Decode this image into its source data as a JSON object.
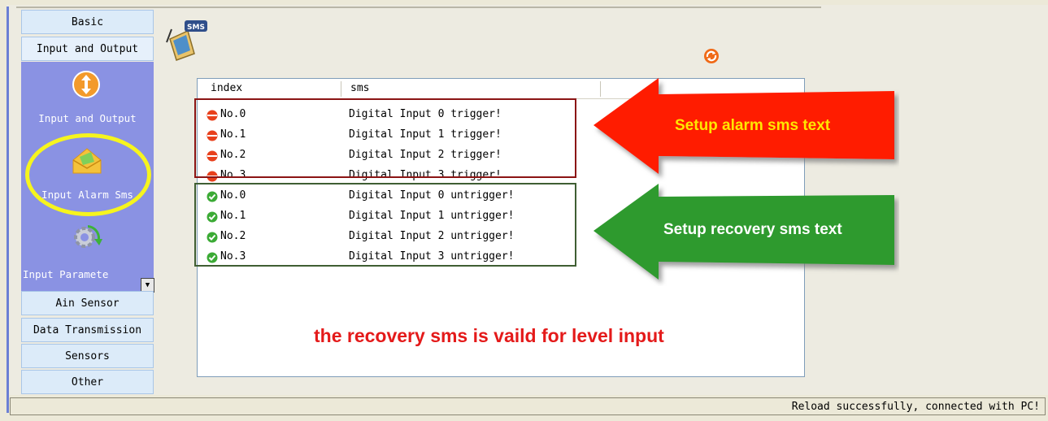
{
  "sidebar": {
    "top_categories": [
      "Basic",
      "Input and Output"
    ],
    "items": [
      {
        "label": "Input and Output",
        "icon": "swap-arrows-icon"
      },
      {
        "label": "Input Alarm Sms",
        "icon": "envelope-icon"
      },
      {
        "label": "Input Paramete",
        "icon": "gear-refresh-icon"
      }
    ],
    "bottom_categories": [
      "Ain Sensor",
      "Data Transmission",
      "Sensors",
      "Other"
    ]
  },
  "grid": {
    "headers": {
      "index": "index",
      "sms": "sms"
    },
    "alarm_rows": [
      {
        "index": "No.0",
        "sms": "Digital Input 0 trigger!"
      },
      {
        "index": "No.1",
        "sms": "Digital Input 1 trigger!"
      },
      {
        "index": "No.2",
        "sms": "Digital Input 2 trigger!"
      },
      {
        "index": "No.3",
        "sms": "Digital Input 3 trigger!"
      }
    ],
    "recovery_rows": [
      {
        "index": "No.0",
        "sms": "Digital Input 0 untrigger!"
      },
      {
        "index": "No.1",
        "sms": "Digital Input 1 untrigger!"
      },
      {
        "index": "No.2",
        "sms": "Digital Input 2 untrigger!"
      },
      {
        "index": "No.3",
        "sms": "Digital Input 3 untrigger!"
      }
    ]
  },
  "annotations": {
    "alarm_arrow": "Setup alarm sms text",
    "recovery_arrow": "Setup recovery sms text",
    "note": "the recovery sms is vaild for level input"
  },
  "logo": {
    "badge": "SMS"
  },
  "status": {
    "text": "Reload successfully, connected with PC!"
  },
  "colors": {
    "alarm": "#E8401C",
    "recovery": "#3BAA35",
    "panel": "#8A92E3",
    "note": "#E41A1A"
  }
}
